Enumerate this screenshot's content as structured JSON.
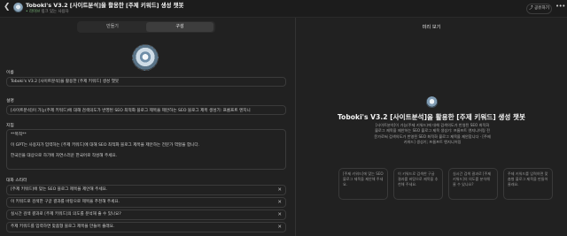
{
  "header": {
    "title": "Toboki's V3.2 [사이트분석]을 활용한 [주제 키워드] 생성 챗봇",
    "status": "• 라이브",
    "visibility": "링크 있는 사용자",
    "share_label": "공유하기",
    "back_icon": "chevron-left-icon",
    "more_icon": "more-horizontal-icon"
  },
  "tabs": [
    {
      "label": "만들기"
    },
    {
      "label": "구성"
    }
  ],
  "form": {
    "name_label": "이름",
    "name_value": "Toboki's V3.2 [사이트분석]을 활용한 [주제 키워드] 생성 챗봇",
    "desc_label": "설명",
    "desc_value": "[사이트분석]이 가능(주제 키워드)에 대해 검색의도가 반영된 SEO 최적화 블로그 제목을 제안하는 SEO 블로그 제목 생성기: 프롬프트 엔지니",
    "instr_label": "지침",
    "instr_lines": [
      "**목적**",
      "이 GPT는 사용자가 입력하는 [주제 키워드]에 대해 SEO 최적화 블로그 제목을 제안하는 전문가 역할을 합니다.",
      "한국인을 대상으로 하기에 자연스러운 한국어로 작성해 주세요."
    ],
    "starters_label": "대화 스타터",
    "starters": [
      "[주제 키워드]에 맞는 SEO 블로그 제목을 제안해 주세요.",
      "이 키워드로 검색한 구글 결과를 바탕으로 제목을 추천해 주세요.",
      "실시간 검색 결과로 [주제 키워드]의 의도를 분석해 줄 수 있나요?",
      "주제 키워드를 입력하면 맞춤형 블로그 제목을 만들어 줄래요."
    ]
  },
  "preview": {
    "title": "미리 보기",
    "gpt_name": "Toboki's V3.2 [사이트분석]을 활용한 [주제 키워드] 생성 챗봇",
    "description": "[사이트분석]이 가능(주제 키워드)에 대해 검색의도가 반영된 SEO 최적화 블로그 제목을 제안하는 SEO 블로그 제목 생성기: 프롬프트 엔지니어링 전문가로써 검색의도가 반영된 SEO 최적화 블로그 제목을 제안합니다 · [주제 키워드] 생성기; 프롬프트 엔지니어링",
    "cards": [
      "[주제 키워드]에 맞는 SEO 블로그 제목을 제안해 주세요.",
      "이 키워드로 검색한 구글 결과를 바탕으로 제목을 추천해 주세요.",
      "실시간 검색 결과로 [주제 키워드]의 의도를 분석해 줄 수 있나요?",
      "주제 키워드를 입력하면 맞춤형 블로그 제목을 만들어 줄래요."
    ]
  },
  "colors": {
    "background": "#212121",
    "border": "#3b3b3b",
    "text": "#ececec",
    "muted": "#9a9a9a"
  }
}
